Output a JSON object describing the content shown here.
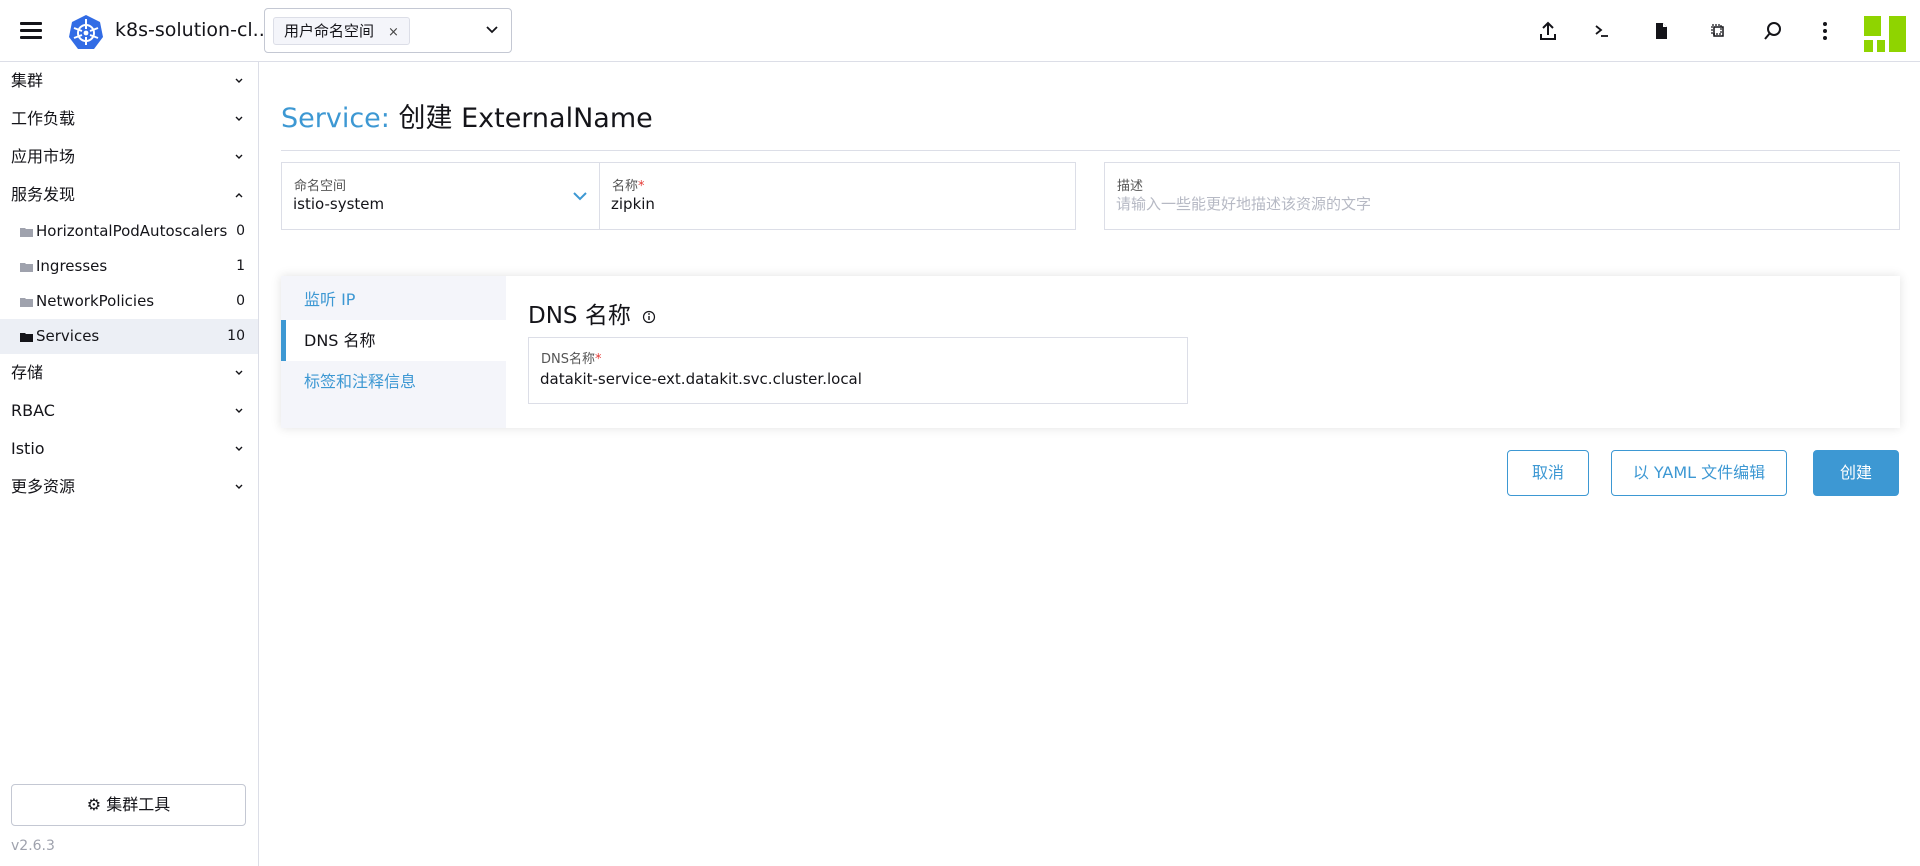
{
  "topbar": {
    "cluster_name": "k8s-solution-cl...",
    "namespace_chip": "用户命名空间",
    "namespace_chip_remove": "×",
    "icons": [
      "menu-icon",
      "kubernetes-logo",
      "upload-icon",
      "terminal-icon",
      "file-icon",
      "copy-config-icon",
      "search-icon",
      "more-vertical-icon",
      "user-avatar"
    ]
  },
  "sidebar": {
    "groups_top": [
      {
        "label": "集群",
        "expanded": false
      },
      {
        "label": "工作负载",
        "expanded": false
      },
      {
        "label": "应用市场",
        "expanded": false
      },
      {
        "label": "服务发现",
        "expanded": true
      }
    ],
    "sub_items": [
      {
        "label": "HorizontalPodAutoscalers",
        "count": "0"
      },
      {
        "label": "Ingresses",
        "count": "1"
      },
      {
        "label": "NetworkPolicies",
        "count": "0"
      },
      {
        "label": "Services",
        "count": "10",
        "active": true
      }
    ],
    "groups_bottom": [
      {
        "label": "存储",
        "expanded": false
      },
      {
        "label": "RBAC",
        "expanded": false
      },
      {
        "label": "Istio",
        "expanded": false
      },
      {
        "label": "更多资源",
        "expanded": false
      }
    ],
    "cluster_tools": "集群工具",
    "version": "v2.6.3"
  },
  "page": {
    "title_prefix": "Service:",
    "title_main": "创建 ExternalName"
  },
  "form": {
    "namespace_label": "命名空间",
    "namespace_value": "istio-system",
    "name_label": "名称",
    "name_value": "zipkin",
    "required_mark": "*",
    "description_label": "描述",
    "description_placeholder": "请输入一些能更好地描述该资源的文字"
  },
  "tabs": {
    "items": [
      {
        "label": "监听 IP",
        "active": false
      },
      {
        "label": "DNS 名称",
        "active": true
      },
      {
        "label": "标签和注释信息",
        "active": false
      }
    ],
    "panel_title": "DNS 名称",
    "dns_label": "DNS名称",
    "dns_value": "datakit-service-ext.datakit.svc.cluster.local"
  },
  "actions": {
    "cancel": "取消",
    "edit_yaml": "以 YAML 文件编辑",
    "create": "创建"
  },
  "colors": {
    "accent": "#3d98d3",
    "border": "#dcdee7",
    "required": "#e53935",
    "brand": "#8fd400"
  }
}
